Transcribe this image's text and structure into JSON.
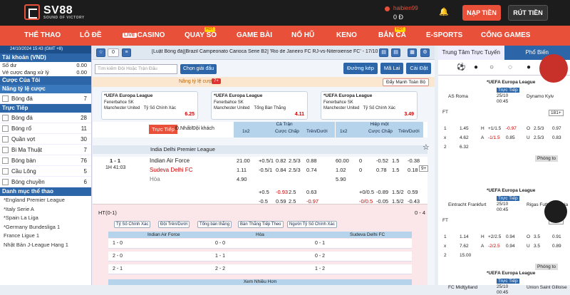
{
  "brand": {
    "name": "SV88",
    "tagline": "SOUND OF VICTORY"
  },
  "user": {
    "name": "haibien99",
    "balance": "0 Đ"
  },
  "header": {
    "deposit": "NẠP TIỀN",
    "withdraw": "RÚT TIỀN"
  },
  "nav": {
    "items": [
      "THỂ THAO",
      "LÔ ĐỀ",
      "CASINO",
      "QUAY SỐ",
      "GAME BÀI",
      "NỔ HŨ",
      "KENO",
      "BẮN CÁ",
      "E-SPORTS",
      "CỔNG GAMES"
    ],
    "live_badge": "LIVE",
    "hot": "HOT"
  },
  "sidebar": {
    "datetime": "24/10/2024 15:43 (GMT +8)",
    "account_title": "Tài khoản (VND)",
    "balance_label": "Số dư",
    "balance_value": "0.00",
    "pending_label": "Vé cược đang xử lý",
    "pending_value": "0.00",
    "my_bets": "Cược Của Tôi",
    "raise_odds": "Nâng tỷ lệ cược",
    "raise_items": [
      {
        "label": "Bóng đá",
        "count": "7"
      }
    ],
    "live_title": "Trực Tiếp",
    "live_items": [
      {
        "label": "Bóng đá",
        "count": "28"
      },
      {
        "label": "Bóng rổ",
        "count": "11"
      },
      {
        "label": "Quần vợt",
        "count": "30"
      },
      {
        "label": "Bi Ma Thuật",
        "count": "7"
      },
      {
        "label": "Bóng bàn",
        "count": "76"
      },
      {
        "label": "Cầu Lông",
        "count": "5"
      },
      {
        "label": "Bóng chuyền",
        "count": "6"
      }
    ],
    "leagues_title": "Danh mục thể thao",
    "leagues": [
      "*England Premier League",
      "*Italy Serie A",
      "*Spain La Liga",
      "*Germany Bundesliga 1",
      "France Ligue 1",
      "Nhật Bản J-League Hạng 1"
    ]
  },
  "main": {
    "ticker": "[Luật Bóng đá][Brazil Campeonato Carioca Serie B2] 'Rio de Janeiro FC RJ-vs-Niteroiense FC' - 17/10. Đ",
    "search_placeholder": "Tìm kiếm Đội Hoặc Trận Đấu",
    "choose_league": "Chọn giải đấu",
    "odds_type": "Đường kép",
    "market": "Mã Lai",
    "sort": "Cài Đặt",
    "raise_label": "Nâng tỷ lệ cược",
    "raise_count": "7+",
    "parlay": "Đẩy Mạnh Toàn Bộ",
    "cards": [
      {
        "league": "*UEFA Europa League",
        "home": "Fenerbahce SK",
        "away": "Manchester United",
        "market": "Tỷ Số Chính Xác",
        "score": "1:1",
        "odds": "6.25"
      },
      {
        "league": "*UEFA Europa League",
        "home": "Fenerbahce SK",
        "away": "Manchester United",
        "market": "Tổng Bàn Thắng",
        "score": "",
        "odds": "4.11"
      },
      {
        "league": "*UEFA Europa League",
        "home": "Fenerbahce SK",
        "away": "Manchester United",
        "market": "Tỷ Số Chính Xác",
        "score": "2:1",
        "odds": "3.49"
      }
    ],
    "table_header": {
      "live": "Trực Tiếp",
      "tab2": "Đ.Nhất/Đội khách",
      "full": "Cả Trận",
      "half": "Hiệp một",
      "c1": "1x2",
      "c2": "Cược Chấp",
      "c3": "Trên/Dưới"
    },
    "league": "India Delhi Premier League",
    "match": {
      "score": "1 - 1",
      "time": "1H 41:03",
      "home": "Indian Air Force",
      "away": "Sudeva Delhi FC",
      "draw": "Hòa",
      "more": "9+"
    },
    "rows": [
      [
        "21.00",
        "+0.5/1",
        "0.82",
        "2.5/3",
        "0.88",
        "60.00",
        "0",
        "-0.52",
        "1.5",
        "-0.38"
      ],
      [
        "1.11",
        "-0.5/1",
        "0.84",
        "2.5/3",
        "0.74",
        "1.02",
        "0",
        "0.78",
        "1.5",
        "0.18"
      ],
      [
        "4.90",
        "",
        "",
        "",
        "",
        "5.90",
        "",
        "",
        "",
        ""
      ],
      [
        "",
        "+0.5",
        "-0.93",
        "2.5",
        "0.63",
        "",
        "+0/0.5",
        "-0.89",
        "1.5/2",
        "0.59"
      ],
      [
        "",
        "-0.5",
        "0.59",
        "2.5",
        "-0.97",
        "",
        "-0/0.5",
        "-0.05",
        "1.5/2",
        "-0.43"
      ]
    ],
    "ht_label": "HT(0-1)",
    "ht_score": "0 - 4",
    "chips": [
      "Tỷ Số Chính Xác",
      "Đội Trên/Dưới",
      "Tổng bàn thắng",
      "Bàn Thắng Tiếp Theo",
      "Người Tỷ Số Chính Xác"
    ],
    "grid_header": [
      "Indian Air Force",
      "Hòa",
      "Sudeva Delhi FC"
    ],
    "grid": [
      [
        "1 - 0",
        "0 - 0",
        "0 - 1"
      ],
      [
        "2 - 0",
        "1 - 1",
        "0 - 2"
      ],
      [
        "2 - 1",
        "2 - 2",
        "1 - 2"
      ]
    ],
    "see_more": "Xem Nhiều Hơn"
  },
  "right": {
    "tab_live": "Trung Tâm Trực Tuyến",
    "tab_popular": "Phổ Biến",
    "matches": [
      {
        "league": "*UEFA Europa League",
        "home": "AS Roma",
        "away": "Dynamo Kyiv",
        "status": "Trực Tiếp",
        "date": "25/10",
        "time": "00:45",
        "ft": "FT",
        "more": "181+",
        "r1": [
          "1",
          "1.45",
          "H",
          "+1/1.5",
          "-0.97",
          "O",
          "2.5/3",
          "0.97"
        ],
        "r2": [
          "x",
          "4.62",
          "A",
          "-1/1.5",
          "0.85",
          "U",
          "2.5/3",
          "0.83"
        ],
        "r3": [
          "2",
          "6.32"
        ],
        "more_btn": "Phóng to"
      },
      {
        "league": "*UEFA Europa League",
        "home": "Eintracht Frankfurt",
        "away": "Rigas Futbola Skola",
        "status": "Trực Tiếp",
        "date": "25/10",
        "time": "00:45",
        "ft": "FT",
        "more": "176+",
        "r1": [
          "1",
          "1.14",
          "H",
          "+2/2.5",
          "0.94",
          "O",
          "3.5",
          "0.91"
        ],
        "r2": [
          "x",
          "7.62",
          "A",
          "-2/2.5",
          "0.94",
          "U",
          "3.5",
          "0.89"
        ],
        "r3": [
          "2",
          "15.00"
        ],
        "more_btn": "Phóng to"
      },
      {
        "league": "*UEFA Europa League",
        "home": "FC Midtjylland",
        "away": "Union Saint Gilloise",
        "status": "Trực Tiếp",
        "date": "25/10",
        "time": "00:45"
      }
    ]
  }
}
